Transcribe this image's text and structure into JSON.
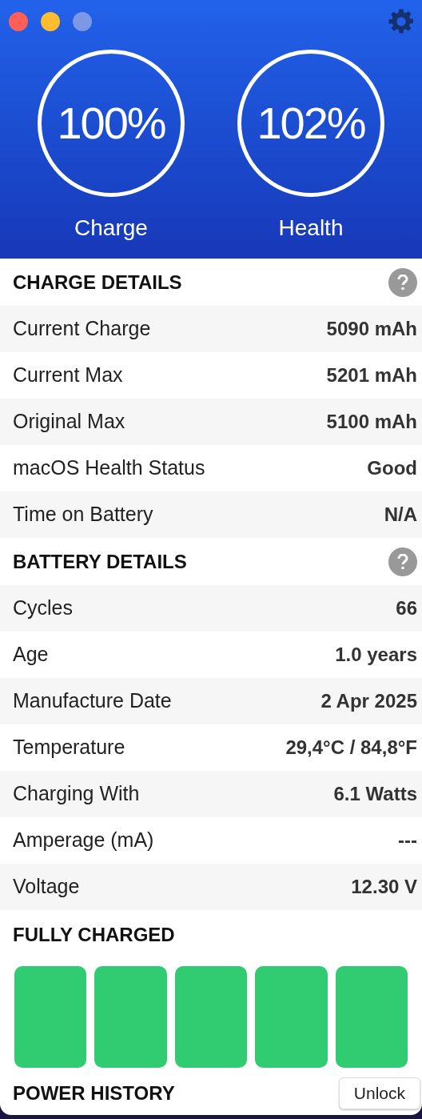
{
  "window_controls": [
    {
      "kind": "close",
      "disabled": false
    },
    {
      "kind": "minimize",
      "disabled": false
    },
    {
      "kind": "zoom",
      "disabled": true
    }
  ],
  "gauges": [
    {
      "value": "100%",
      "label": "Charge"
    },
    {
      "value": "102%",
      "label": "Health"
    }
  ],
  "sections": [
    {
      "title": "CHARGE DETAILS",
      "help": true,
      "rows": [
        {
          "label": "Current Charge",
          "value": "5090 mAh"
        },
        {
          "label": "Current Max",
          "value": "5201 mAh"
        },
        {
          "label": "Original Max",
          "value": "5100 mAh"
        },
        {
          "label": "macOS Health Status",
          "value": "Good"
        },
        {
          "label": "Time on Battery",
          "value": "N/A"
        }
      ]
    },
    {
      "title": "BATTERY DETAILS",
      "help": true,
      "rows": [
        {
          "label": "Cycles",
          "value": "66"
        },
        {
          "label": "Age",
          "value": "1.0 years"
        },
        {
          "label": "Manufacture Date",
          "value": "2 Apr 2025"
        },
        {
          "label": "Temperature",
          "value": "29,4°C / 84,8°F"
        },
        {
          "label": "Charging With",
          "value": "6.1 Watts"
        },
        {
          "label": "Amperage (mA)",
          "value": "---"
        },
        {
          "label": "Voltage",
          "value": "12.30 V"
        }
      ]
    }
  ],
  "charge_state": {
    "title": "FULLY CHARGED",
    "level": 1
  },
  "power_history": {
    "title": "POWER HISTORY",
    "button": "Unlock"
  }
}
